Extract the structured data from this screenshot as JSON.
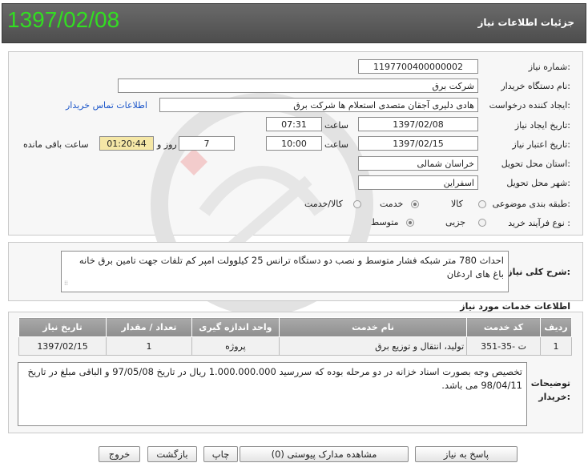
{
  "header": {
    "title": "جزئیات اطلاعات نیاز",
    "date": "1397/02/08"
  },
  "form": {
    "need_number": {
      "label": "شماره نیاز:",
      "value": "1197700400000002"
    },
    "buyer_org": {
      "label": "نام دستگاه خریدار:",
      "value": "شرکت برق"
    },
    "requester": {
      "label": "ایجاد کننده درخواست:",
      "value": "هادی دلیری آجقان متصدی استعلام ها  شرکت برق",
      "contact_link": "اطلاعات تماس خریدار"
    },
    "created": {
      "label": "تاریخ ایجاد نیاز:",
      "date": "1397/02/08",
      "time_label": "ساعت",
      "time": "07:31"
    },
    "validity": {
      "label": "تاریخ اعتبار نیاز:",
      "date": "1397/02/15",
      "time_label": "ساعت",
      "time": "10:00",
      "days": "7",
      "days_label": "روز و",
      "remaining": "01:20:44",
      "remaining_label": "ساعت باقی مانده"
    },
    "province": {
      "label": "استان محل تحویل:",
      "value": "خراسان شمالی"
    },
    "city": {
      "label": "شهر محل تحویل:",
      "value": "اسفراین"
    },
    "category": {
      "label": "طبقه بندی موضوعی:",
      "options": [
        "کالا",
        "خدمت",
        "کالا/خدمت"
      ],
      "selected": "خدمت"
    },
    "process": {
      "label": "نوع فرآیند خرید :",
      "options": [
        "جزیی",
        "متوسط"
      ],
      "selected": "متوسط"
    }
  },
  "description": {
    "label": "شرح کلی نیاز:",
    "text": "احداث 780 متر شبکه فشار متوسط و نصب دو دستگاه ترانس 25 کیلوولت امپر کم تلفات جهت تامین برق خانه باغ های اردغان"
  },
  "services": {
    "title": "اطلاعات خدمات مورد نیاز",
    "headers": [
      "ردیف",
      "کد خدمت",
      "نام خدمت",
      "واحد اندازه گیری",
      "تعداد / مقدار",
      "تاریخ نیاز"
    ],
    "rows": [
      [
        "1",
        "ت -35-351",
        "تولید، انتقال و توزیع برق",
        "پروژه",
        "1",
        "1397/02/15"
      ]
    ]
  },
  "buyer_notes": {
    "label": "توضیحات خریدار:",
    "text": "تخصیص وجه بصورت اسناد خزانه در دو مرحله بوده که سررسید 1.000.000.000 ریال در تاریخ 97/05/08 و الباقی مبلغ در تاریخ 98/04/11 می باشد."
  },
  "buttons": {
    "reply": "پاسخ به نیاز",
    "attachments": "مشاهده مدارک پیوستی (0)",
    "print": "چاپ",
    "back": "بازگشت",
    "exit": "خروج"
  },
  "colors": {
    "header_date": "#33dd22",
    "link": "#1a55c9",
    "remaining_bg": "#f5e7a6"
  }
}
